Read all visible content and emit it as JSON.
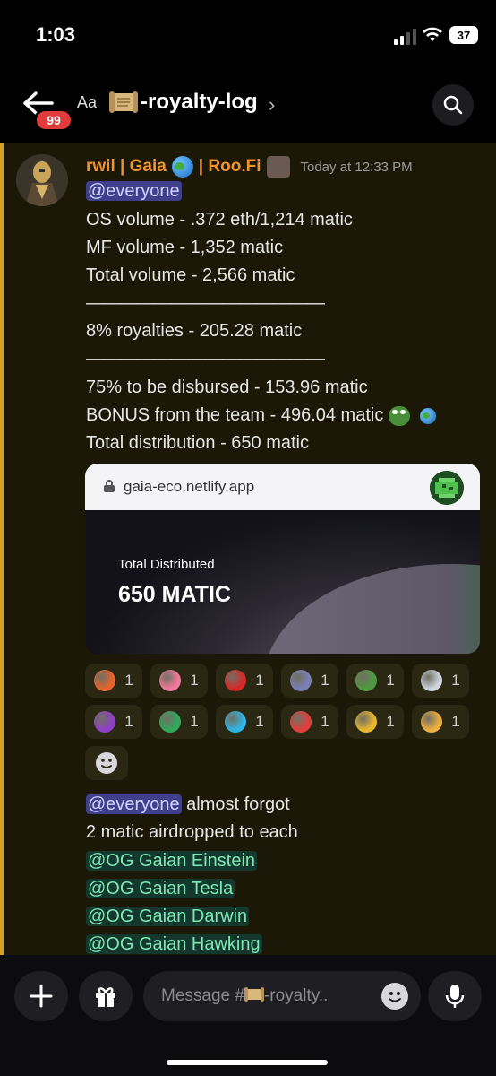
{
  "status_bar": {
    "time": "1:03",
    "battery": "37"
  },
  "header": {
    "badge": "99",
    "text_size_label": "Aa",
    "channel_name": "-royalty-log",
    "chevron": "›"
  },
  "message": {
    "author": "rwil | Gaia",
    "author_mid": "| Roo.Fi",
    "timestamp": "Today at 12:33 PM",
    "mention": "@everyone",
    "lines": [
      "OS volume - .372 eth/1,214 matic",
      "MF volume - 1,352 matic",
      "Total volume - 2,566 matic",
      "——————————————",
      "8% royalties - 205.28 matic",
      "——————————————",
      "75% to be disbursed - 153.96 matic",
      "BONUS from the team - 496.04 matic",
      "Total distribution - 650 matic"
    ],
    "embed": {
      "url": "gaia-eco.netlify.app",
      "label": "Total Distributed",
      "value": "650 MATIC"
    },
    "reactions": [
      {
        "icon": "fire-heart-icon",
        "count": "1",
        "color": "#e8632b"
      },
      {
        "icon": "pepe-thumb-icon",
        "count": "1",
        "color": "#f27a9c"
      },
      {
        "icon": "red-swirl-icon",
        "count": "1",
        "color": "#d62727"
      },
      {
        "icon": "black-heart-icon",
        "count": "1",
        "color": "#7a7fb5"
      },
      {
        "icon": "pepe-frog-icon",
        "count": "1",
        "color": "#4e9a3f"
      },
      {
        "icon": "damn-pepe-icon",
        "count": "1",
        "color": "#cfd6e0"
      },
      {
        "icon": "purple-orb-icon",
        "count": "1",
        "color": "#8e3fc7"
      },
      {
        "icon": "green-orb-icon",
        "count": "1",
        "color": "#2fa85a"
      },
      {
        "icon": "blue-fire-icon",
        "count": "1",
        "color": "#2fb6e8"
      },
      {
        "icon": "hundred-icon",
        "count": "1",
        "color": "#e23d3d"
      },
      {
        "icon": "money-bag-icon",
        "count": "1",
        "color": "#e8b72b"
      },
      {
        "icon": "handshake-icon",
        "count": "1",
        "color": "#f0b040"
      }
    ]
  },
  "message2": {
    "mention": "@everyone",
    "text1": " almost forgot",
    "text2": "2 matic airdropped to each",
    "roles": [
      "@OG Gaian Einstein",
      "@OG Gaian Tesla",
      "@OG Gaian Darwin",
      "@OG Gaian Hawking"
    ]
  },
  "composer": {
    "placeholder_prefix": "Message #",
    "placeholder_suffix": "-royalty.."
  }
}
